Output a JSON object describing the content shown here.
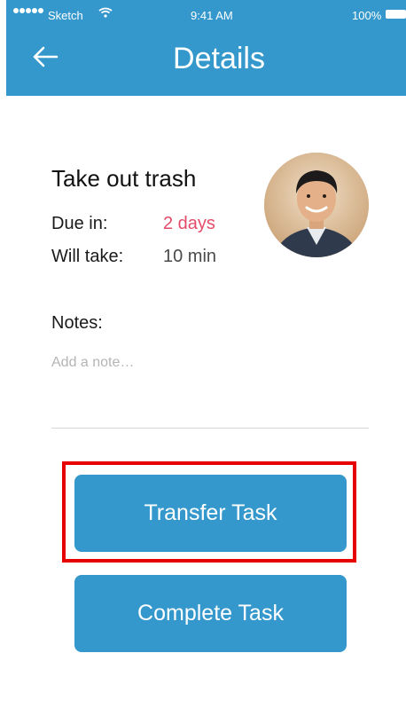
{
  "status_bar": {
    "carrier": "Sketch",
    "time": "9:41 AM",
    "battery": "100%"
  },
  "header": {
    "title": "Details",
    "back_icon": "arrow-left-icon"
  },
  "task": {
    "title": "Take out trash",
    "due_label": "Due in:",
    "due_value": "2 days",
    "duration_label": "Will take:",
    "duration_value": "10 min"
  },
  "notes": {
    "label": "Notes:",
    "placeholder": "Add a note…"
  },
  "actions": {
    "transfer_label": "Transfer Task",
    "complete_label": "Complete Task"
  },
  "colors": {
    "primary": "#3498cc",
    "due_accent": "#e44b69",
    "highlight": "#e60000"
  }
}
